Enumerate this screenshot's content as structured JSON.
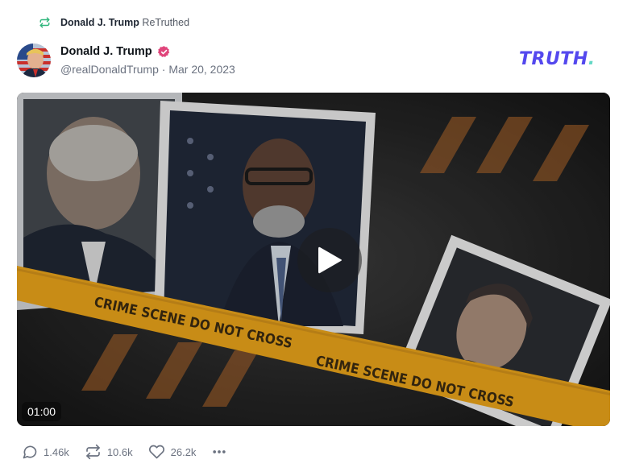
{
  "retruth": {
    "name": "Donald J. Trump",
    "label": "ReTruthed",
    "icon": "retruth-icon"
  },
  "author": {
    "name": "Donald J. Trump",
    "verified_icon": "verified-badge-icon",
    "handle": "@realDonaldTrump",
    "separator": "·",
    "date": "Mar 20, 2023"
  },
  "brand": {
    "logo_text": "TRUTH",
    "logo_dot": ".",
    "colors": {
      "primary": "#5448ee",
      "accent": "#65d8c6",
      "verified": "#e0457b",
      "retruth": "#2fb67c"
    }
  },
  "video": {
    "duration": "01:00",
    "play_icon": "play-icon",
    "tape_text": "CRIME SCENE DO NOT CROSS"
  },
  "actions": {
    "replies": "1.46k",
    "retruths": "10.6k",
    "likes": "26.2k",
    "more_icon": "more-icon"
  }
}
